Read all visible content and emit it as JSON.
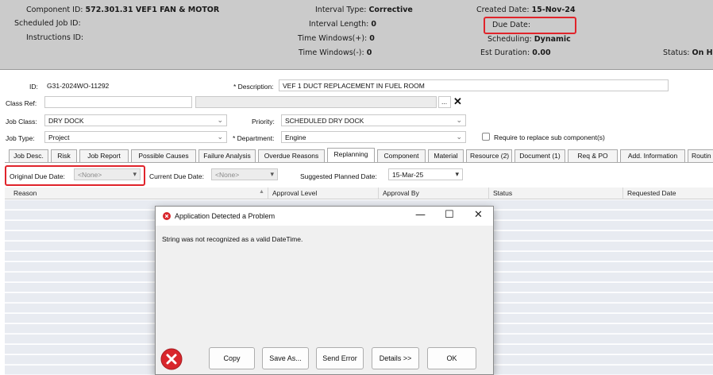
{
  "header": {
    "component_id_label": "Component ID:",
    "component_id_value": "572.301.31 VEF1 FAN & MOTOR",
    "scheduled_job_label": "Scheduled Job ID:",
    "instructions_label": "Instructions ID:",
    "interval_type_label": "Interval Type:",
    "interval_type_value": "Corrective",
    "interval_length_label": "Interval Length:",
    "interval_length_value": "0",
    "time_windows_plus_label": "Time Windows(+):",
    "time_windows_plus_value": "0",
    "time_windows_minus_label": "Time Windows(-):",
    "time_windows_minus_value": "0",
    "created_date_label": "Created Date:",
    "created_date_value": "15-Nov-24",
    "due_date_label": "Due Date:",
    "scheduling_label": "Scheduling:",
    "scheduling_value": "Dynamic",
    "est_duration_label": "Est Duration:",
    "est_duration_value": "0.00",
    "status_label": "Status:",
    "status_value": "On Ho"
  },
  "form": {
    "id_label": "ID:",
    "id_value": "G31-2024WO-11292",
    "description_label": "* Description:",
    "description_value": "VEF 1 DUCT REPLACEMENT IN FUEL ROOM",
    "class_ref_label": "Class Ref:",
    "class_ref_value": "",
    "browse_label": "...",
    "clear_label": "✕",
    "job_class_label": "Job Class:",
    "job_class_value": "DRY DOCK",
    "priority_label": "Priority:",
    "priority_value": "SCHEDULED DRY DOCK",
    "job_type_label": "Job Type:",
    "job_type_value": "Project",
    "department_label": "* Department:",
    "department_value": "Engine",
    "replace_sub_label": "Require to replace sub component(s)"
  },
  "tabs": [
    "Job Desc.",
    "Risk",
    "Job Report",
    "Possible Causes",
    "Failure Analysis",
    "Overdue Reasons",
    "Replanning",
    "Component",
    "Material",
    "Resource (2)",
    "Document (1)",
    "Req & PO",
    "Add. Information",
    "Routin"
  ],
  "replanning": {
    "original_due_label": "Original Due Date:",
    "original_due_value": "<None>",
    "current_due_label": "Current Due Date:",
    "current_due_value": "<None>",
    "suggested_label": "Suggested Planned Date:",
    "suggested_value": "15-Mar-25"
  },
  "grid": {
    "columns": [
      "Reason",
      "Approval Level",
      "Approval By",
      "Status",
      "Requested Date"
    ]
  },
  "dialog": {
    "title": "Application Detected a Problem",
    "message": "String was not recognized as a valid DateTime.",
    "minimize": "—",
    "maximize": "☐",
    "close": "✕",
    "buttons": [
      "Copy",
      "Save As...",
      "Send Error",
      "Details >>",
      "OK"
    ]
  },
  "colors": {
    "header_bg": "#cbcbcb",
    "highlight": "#e0242b",
    "error_red": "#d9262c",
    "grid_row": "#e8ebf1"
  }
}
